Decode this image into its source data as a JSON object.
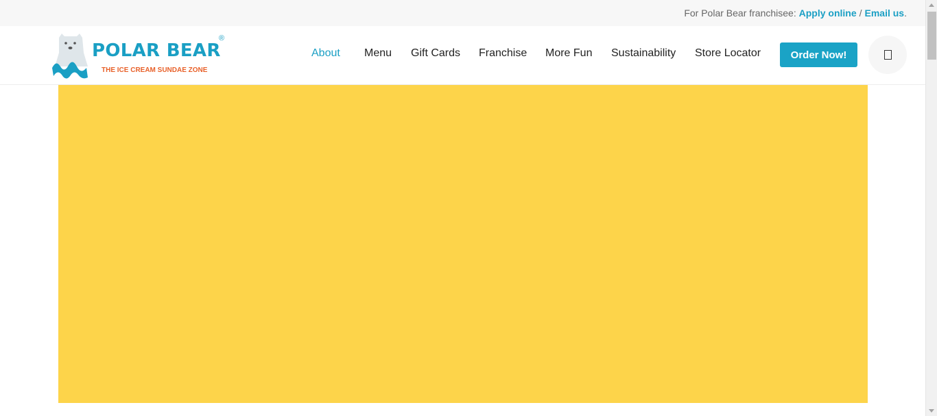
{
  "topbar": {
    "prefix": "For Polar Bear franchisee:",
    "apply_link": "Apply online",
    "separator": "/",
    "email_link": "Email us",
    "suffix": "."
  },
  "logo": {
    "title": "POLAR BEAR",
    "registered": "®",
    "tagline": "THE ICE CREAM SUNDAE ZONE"
  },
  "nav": {
    "items": [
      {
        "label": "About",
        "active": true
      },
      {
        "label": "Menu"
      },
      {
        "label": "Gift Cards"
      },
      {
        "label": "Franchise"
      },
      {
        "label": "More Fun"
      },
      {
        "label": "Sustainability"
      },
      {
        "label": "Store Locator"
      }
    ],
    "order_button": "Order Now!"
  },
  "icons": {
    "header_icon": "cart-icon"
  },
  "colors": {
    "brand_blue": "#1a9fc4",
    "tagline_orange": "#e8612a",
    "hero_yellow": "#fdd44a"
  }
}
